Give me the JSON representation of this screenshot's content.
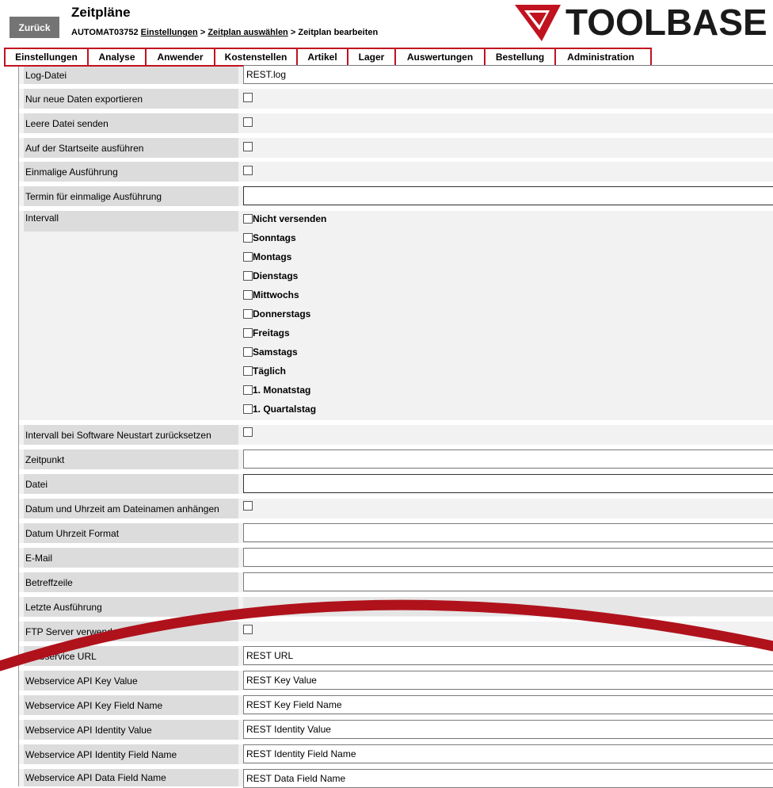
{
  "header": {
    "back_label": "Zurück",
    "title": "Zeitpläne",
    "breadcrumb": {
      "id": "AUTOMAT03752",
      "link1": "Einstellungen",
      "sep1": ">",
      "link2": "Zeitplan auswählen",
      "sep2": ">",
      "current": "Zeitplan bearbeiten"
    },
    "logo_text": "TOOLBASE"
  },
  "nav": [
    "Einstellungen",
    "Analyse",
    "Anwender",
    "Kostenstellen",
    "Artikel",
    "Lager",
    "Auswertungen",
    "Bestellung",
    "Administration"
  ],
  "fields": {
    "log_file": {
      "label": "Log-Datei",
      "value": "REST.log"
    },
    "only_new": {
      "label": "Nur neue Daten exportieren"
    },
    "send_empty": {
      "label": "Leere Datei senden"
    },
    "run_on_start": {
      "label": "Auf der Startseite ausführen"
    },
    "run_once": {
      "label": "Einmalige Ausführung"
    },
    "once_date": {
      "label": "Termin für einmalige Ausführung",
      "value": ""
    },
    "interval": {
      "label": "Intervall",
      "options": [
        "Nicht versenden",
        "Sonntags",
        "Montags",
        "Dienstags",
        "Mittwochs",
        "Donnerstags",
        "Freitags",
        "Samstags",
        "Täglich",
        "1. Monatstag",
        "1. Quartalstag"
      ]
    },
    "reset_interval": {
      "label": "Intervall bei Software Neustart zurücksetzen"
    },
    "time": {
      "label": "Zeitpunkt",
      "value": ""
    },
    "file": {
      "label": "Datei",
      "value": ""
    },
    "append_datetime": {
      "label": "Datum und Uhrzeit am Dateinamen anhängen"
    },
    "datetime_format": {
      "label": "Datum Uhrzeit Format",
      "value": ""
    },
    "email": {
      "label": "E-Mail",
      "value": ""
    },
    "subject": {
      "label": "Betreffzeile",
      "value": ""
    },
    "last_run": {
      "label": "Letzte Ausführung",
      "value": ""
    },
    "ftp": {
      "label": "FTP Server verwenden"
    },
    "ws_url": {
      "label": "Webservice URL",
      "value": "REST URL"
    },
    "ws_key_value": {
      "label": "Webservice API Key Value",
      "value": "REST Key Value"
    },
    "ws_key_field": {
      "label": "Webservice API Key Field Name",
      "value": "REST Key Field Name"
    },
    "ws_identity_value": {
      "label": "Webservice API Identity Value",
      "value": "REST Identity Value"
    },
    "ws_identity_field": {
      "label": "Webservice API Identity Field Name",
      "value": "REST Identity Field Name"
    },
    "ws_data_field": {
      "label": "Webservice API Data Field Name",
      "value": "REST Data Field Name"
    }
  },
  "colors": {
    "brand_red": "#c1121f",
    "label_bg": "#dcdcdc",
    "row_bg": "#f2f2f2",
    "back_button": "#747474"
  }
}
